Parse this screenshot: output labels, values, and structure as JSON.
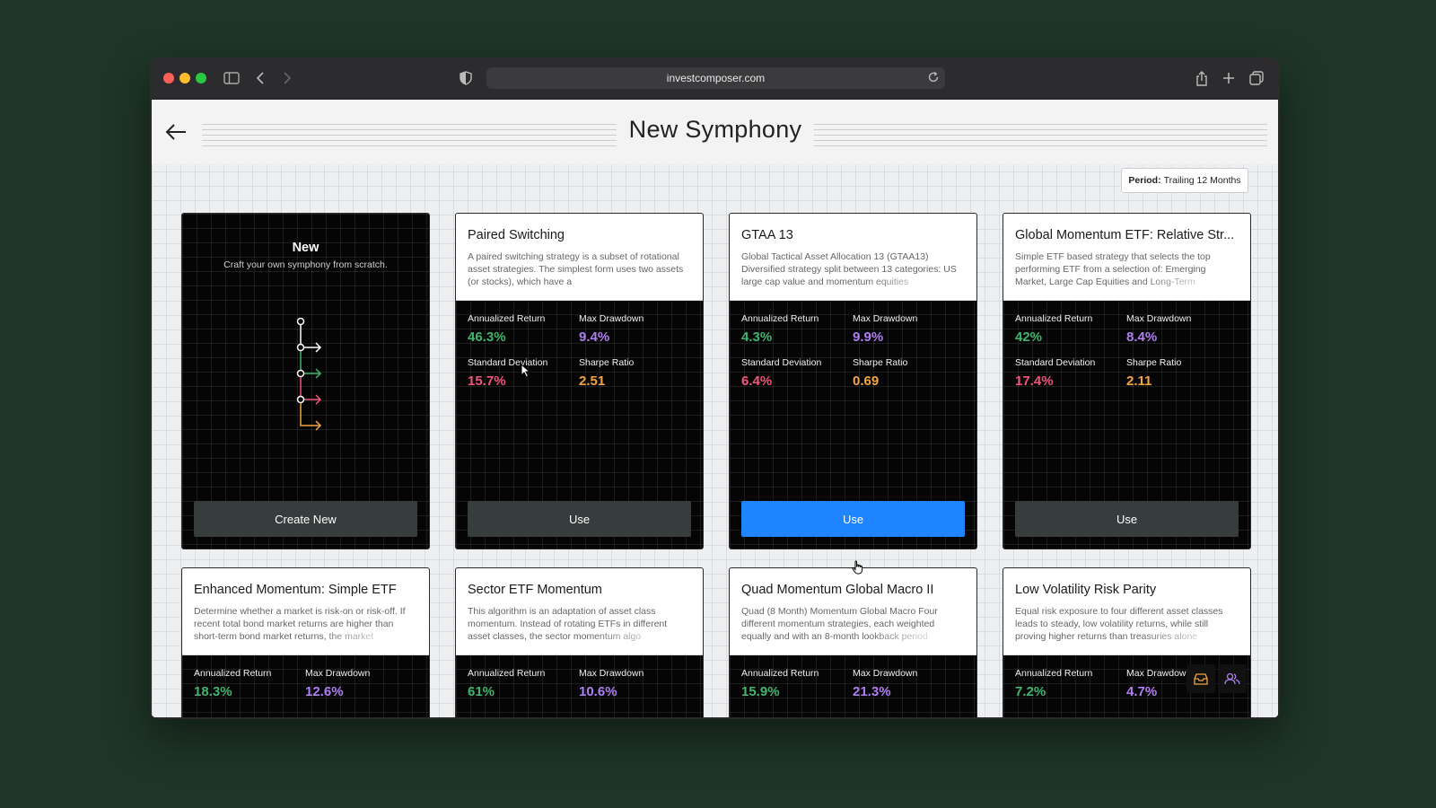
{
  "browser": {
    "url": "investcomposer.com"
  },
  "page": {
    "title": "New Symphony"
  },
  "period": {
    "label": "Period:",
    "value": "Trailing 12 Months"
  },
  "new_card": {
    "title": "New",
    "subtitle": "Craft your own symphony from scratch.",
    "button": "Create New"
  },
  "stat_labels": {
    "annualized_return": "Annualized Return",
    "max_drawdown": "Max Drawdown",
    "standard_deviation": "Standard Deviation",
    "sharpe_ratio": "Sharpe Ratio"
  },
  "cards": [
    {
      "title": "Paired Switching",
      "description": "A paired switching strategy is a subset of rotational asset strategies. The simplest form uses two assets (or stocks), which have a",
      "annualized_return": "46.3%",
      "max_drawdown": "9.4%",
      "standard_deviation": "15.7%",
      "sharpe_ratio": "2.51",
      "button": "Use"
    },
    {
      "title": "GTAA 13",
      "description": "Global Tactical Asset Allocation 13 (GTAA13) Diversified strategy split between 13 categories: US large cap value and momentum equities",
      "annualized_return": "4.3%",
      "max_drawdown": "9.9%",
      "standard_deviation": "6.4%",
      "sharpe_ratio": "0.69",
      "button": "Use"
    },
    {
      "title": "Global Momentum ETF: Relative Str...",
      "description": "Simple ETF based strategy that selects the top performing ETF from a selection of: Emerging Market, Large Cap Equities and Long-Term",
      "annualized_return": "42%",
      "max_drawdown": "8.4%",
      "standard_deviation": "17.4%",
      "sharpe_ratio": "2.11",
      "button": "Use"
    },
    {
      "title": "Enhanced Momentum: Simple ETF",
      "description": "Determine whether a market is risk-on or risk-off. If recent total bond market returns are higher than short-term bond market returns, the market",
      "annualized_return": "18.3%",
      "max_drawdown": "12.6%"
    },
    {
      "title": "Sector ETF Momentum",
      "description": "This algorithm is an adaptation of asset class momentum. Instead of rotating ETFs in different asset classes, the sector momentum algo",
      "annualized_return": "61%",
      "max_drawdown": "10.6%"
    },
    {
      "title": "Quad Momentum Global Macro II",
      "description": "Quad (8 Month) Momentum Global Macro Four different momentum strategies, each weighted equally and with an 8-month lookback period",
      "annualized_return": "15.9%",
      "max_drawdown": "21.3%"
    },
    {
      "title": "Low Volatility Risk Parity",
      "description": "Equal risk exposure to four different asset classes leads to steady, low volatility returns, while still proving higher returns than treasuries alone",
      "annualized_return": "7.2%",
      "max_drawdown": "4.7%"
    }
  ],
  "icons": {
    "back": "arrow-left-icon",
    "inbox": "inbox-icon",
    "users": "users-icon"
  },
  "colors": {
    "accent": "#1f84ff",
    "return": "#3fb56f",
    "drawdown": "#b07ef2",
    "stddev": "#f0557c",
    "sharpe": "#f2a541"
  }
}
